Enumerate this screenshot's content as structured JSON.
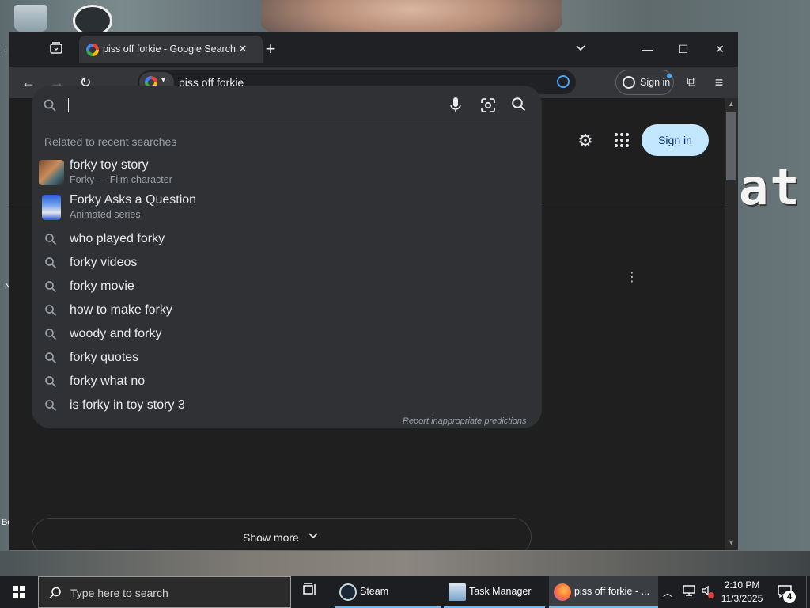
{
  "desktop": {
    "overlay_text": "at",
    "left_edge_letters": [
      "I",
      "N",
      "Bo"
    ]
  },
  "browser": {
    "tab": {
      "title": "piss off forkie - Google Search",
      "close": "✕"
    },
    "new_tab": "+",
    "tab_dropdown": "⌄",
    "window_controls": {
      "minimize": "—",
      "maximize": "☐",
      "close": "✕"
    },
    "toolbar": {
      "back": "←",
      "forward": "→",
      "reload": "↻",
      "address": "piss off forkie",
      "profile_label": "Sign in",
      "extensions": "⧉",
      "menu": "≡"
    }
  },
  "page": {
    "signin_label": "Sign in",
    "show_more_label": "Show more",
    "kebab": "⋮",
    "suggestions": {
      "heading": "Related to recent searches",
      "rich_items": [
        {
          "title": "forky toy story",
          "subtitle": "Forky — Film character"
        },
        {
          "title": "Forky Asks a Question",
          "subtitle": "Animated series"
        }
      ],
      "items": [
        "who played forky",
        "forky videos",
        "forky movie",
        "how to make forky",
        "woody and forky",
        "forky quotes",
        "forky what no",
        "is forky in toy story 3"
      ],
      "report": "Report inappropriate predictions"
    }
  },
  "taskbar": {
    "search_placeholder": "Type here to search",
    "apps": [
      {
        "label": "Steam",
        "color": "#1b2838",
        "active": false
      },
      {
        "label": "Task Manager",
        "color": "#7aa3c7",
        "active": false
      },
      {
        "label": "piss off forkie - ...",
        "color": "#ff7139",
        "active": true
      }
    ],
    "clock": {
      "time": "2:10 PM",
      "date": "11/3/2025"
    },
    "notification_count": "4"
  },
  "colors": {
    "accent_blue": "#4ea5f5",
    "signin_bg": "#c2e7ff",
    "surface": "#303134",
    "page_bg": "#1f1f1f"
  }
}
